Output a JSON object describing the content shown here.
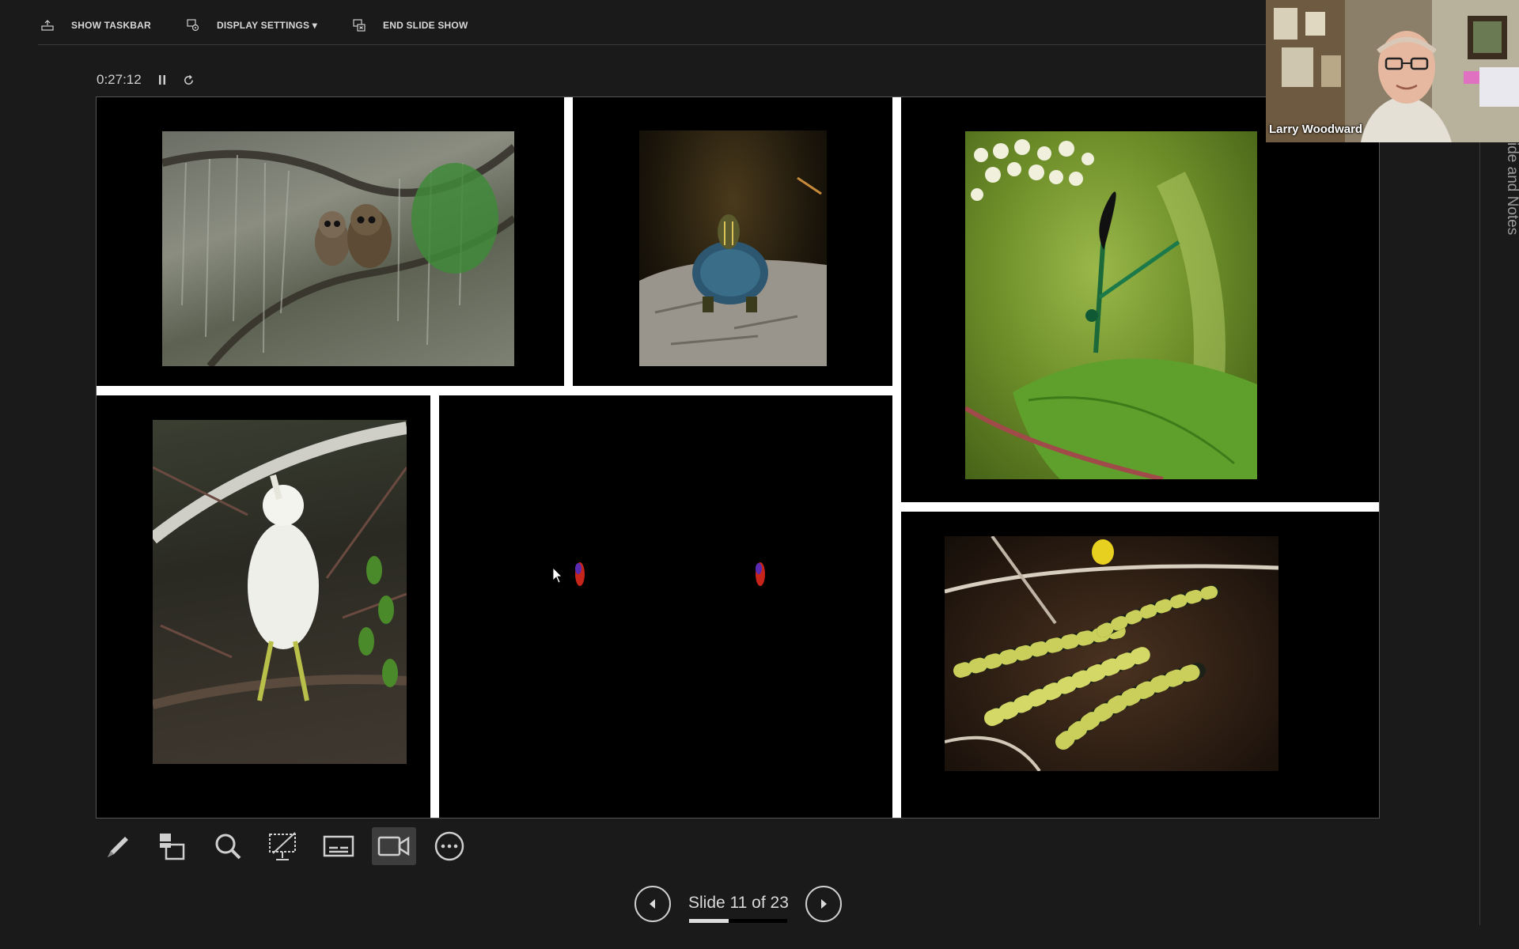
{
  "toolbar": {
    "show_taskbar": "SHOW TASKBAR",
    "display_settings": "DISPLAY SETTINGS ▾",
    "end_slide_show": "END SLIDE SHOW"
  },
  "timer": {
    "elapsed": "0:27:12",
    "pause_icon": "pause-icon",
    "restart_icon": "restart-icon"
  },
  "webcam": {
    "participant_name": "Larry Woodward"
  },
  "side_panel": {
    "label": "ide and Notes"
  },
  "tools": [
    {
      "icon": "pen-icon",
      "active": false
    },
    {
      "icon": "all-slides-icon",
      "active": false
    },
    {
      "icon": "zoom-icon",
      "active": false
    },
    {
      "icon": "pointer-screen-icon",
      "active": false
    },
    {
      "icon": "subtitles-icon",
      "active": false
    },
    {
      "icon": "camera-icon",
      "active": true
    },
    {
      "icon": "more-options-icon",
      "active": false
    }
  ],
  "navigation": {
    "slide_counter": "Slide 11 of 23",
    "current": 11,
    "total": 23,
    "progress_fraction": 0.4
  },
  "slide": {
    "photos": [
      "barred-owls",
      "painted-turtle",
      "ebony-jewelwing-damselfly",
      "juvenile-egret",
      "alligator-eyes-at-night",
      "baby-alligators"
    ]
  }
}
